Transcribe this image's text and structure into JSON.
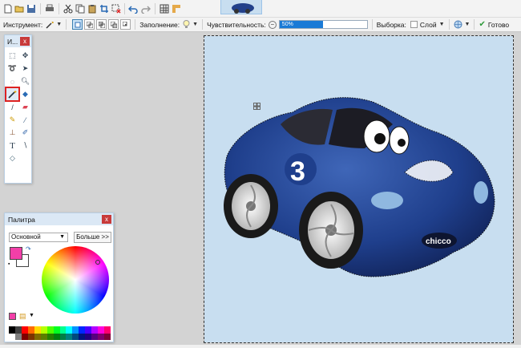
{
  "toolbar": {
    "tool_label": "Инструмент:",
    "fill_label": "Заполнение:",
    "sensitivity_label": "Чувствительность:",
    "sensitivity_value": "50%",
    "sensitivity_fraction": 0.5,
    "selection_label": "Выборка:",
    "layer_label": "Слой",
    "done_label": "Готово"
  },
  "tools_window": {
    "title": "И...",
    "close": "x",
    "icons": [
      "rect-select-icon",
      "move-icon",
      "lasso-icon",
      "move-selection-icon",
      "ellipse-select-icon",
      "zoom-icon",
      "magic-wand-icon",
      "paint-bucket-icon",
      "brush-icon",
      "eraser-icon",
      "pencil-icon",
      "color-picker-icon",
      "clone-stamp-icon",
      "recolor-icon",
      "text-icon",
      "line-icon",
      "shapes-icon"
    ]
  },
  "palette_window": {
    "title": "Палитра",
    "close": "x",
    "mode": "Основной",
    "more": "Больше >>",
    "primary_color": "#f23fa8",
    "secondary_color": "#ffffff",
    "swatches": [
      "#000000",
      "#404040",
      "#ff0000",
      "#ff6a00",
      "#ffd800",
      "#b6ff00",
      "#4cff00",
      "#00ff21",
      "#00ff90",
      "#00ffff",
      "#0094ff",
      "#0026ff",
      "#4800ff",
      "#b200ff",
      "#ff00dc",
      "#ff006e",
      "#ffffff",
      "#808080",
      "#7f0000",
      "#7f3300",
      "#7f6a00",
      "#5b7f00",
      "#267f00",
      "#007f0e",
      "#007f46",
      "#007f7f",
      "#004a7f",
      "#00137f",
      "#21007f",
      "#57007f",
      "#7f006e",
      "#7f0037"
    ]
  },
  "canvas": {
    "background": "#c8def0",
    "car_number": "3",
    "car_badge": "chicco"
  }
}
